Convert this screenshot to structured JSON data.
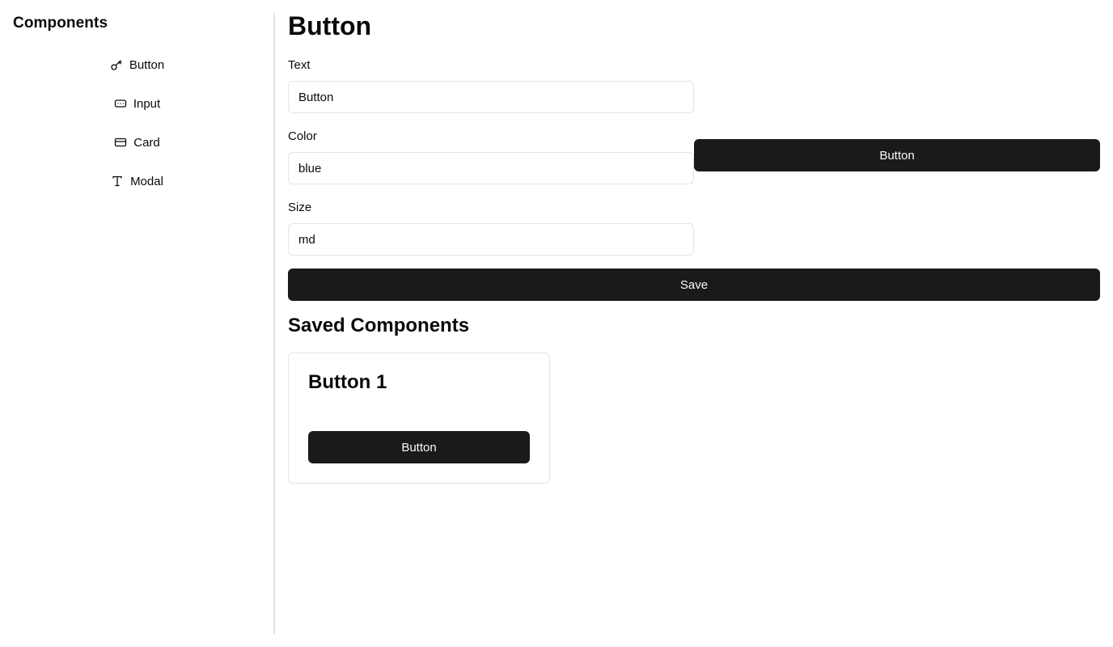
{
  "sidebar": {
    "title": "Components",
    "items": [
      {
        "label": "Button",
        "icon": "key-icon"
      },
      {
        "label": "Input",
        "icon": "input-icon"
      },
      {
        "label": "Card",
        "icon": "card-icon"
      },
      {
        "label": "Modal",
        "icon": "type-icon"
      }
    ]
  },
  "main": {
    "title": "Button",
    "fields": [
      {
        "label": "Text",
        "value": "Button"
      },
      {
        "label": "Color",
        "value": "blue"
      },
      {
        "label": "Size",
        "value": "md"
      }
    ],
    "preview_button_label": "Button",
    "save_label": "Save"
  },
  "saved": {
    "title": "Saved Components",
    "cards": [
      {
        "title": "Button 1",
        "button_label": "Button"
      }
    ]
  },
  "colors": {
    "button_bg": "#1a1a1c",
    "border": "#e4e4e7"
  }
}
